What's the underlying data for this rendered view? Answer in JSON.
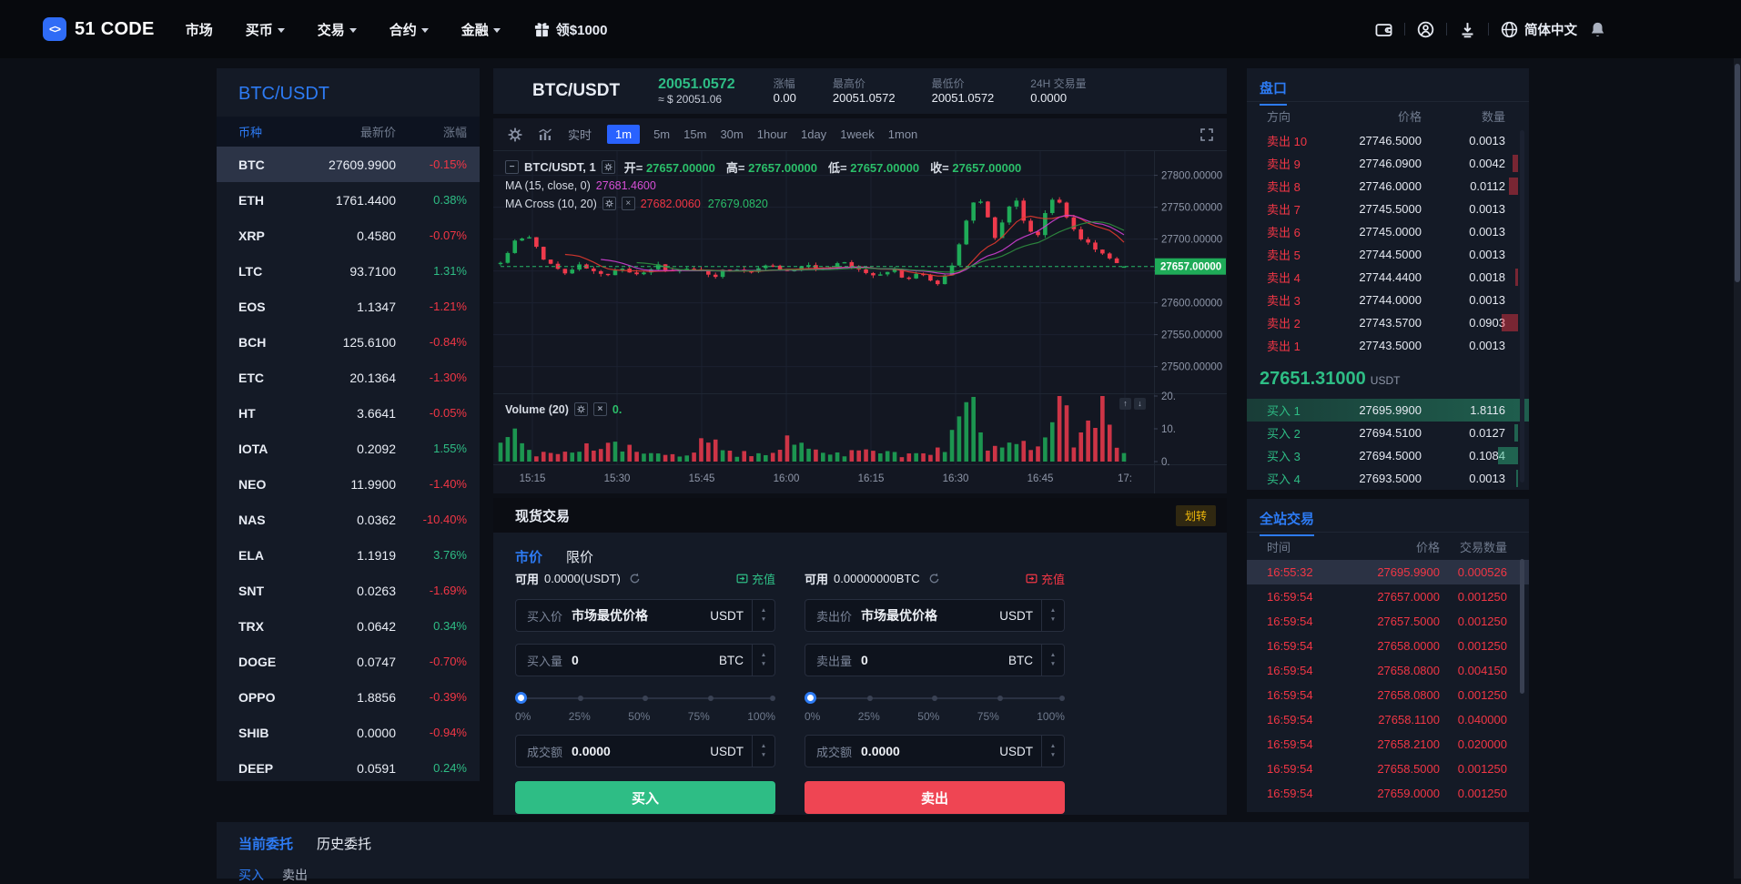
{
  "nav": {
    "logo_text": "51 CODE",
    "items": [
      {
        "label": "市场",
        "caret": false
      },
      {
        "label": "买币",
        "caret": true
      },
      {
        "label": "交易",
        "caret": true
      },
      {
        "label": "合约",
        "caret": true
      },
      {
        "label": "金融",
        "caret": true
      }
    ],
    "promo": "领$1000",
    "language": "简体中文"
  },
  "market": {
    "title": "BTC/USDT",
    "col_coin": "币种",
    "col_price": "最新价",
    "col_change": "涨幅",
    "rows": [
      {
        "coin": "BTC",
        "price": "27609.9900",
        "change": "-0.15%",
        "dir": "down",
        "selected": true
      },
      {
        "coin": "ETH",
        "price": "1761.4400",
        "change": "0.38%",
        "dir": "up"
      },
      {
        "coin": "XRP",
        "price": "0.4580",
        "change": "-0.07%",
        "dir": "down"
      },
      {
        "coin": "LTC",
        "price": "93.7100",
        "change": "1.31%",
        "dir": "up"
      },
      {
        "coin": "EOS",
        "price": "1.1347",
        "change": "-1.21%",
        "dir": "down"
      },
      {
        "coin": "BCH",
        "price": "125.6100",
        "change": "-0.84%",
        "dir": "down"
      },
      {
        "coin": "ETC",
        "price": "20.1364",
        "change": "-1.30%",
        "dir": "down"
      },
      {
        "coin": "HT",
        "price": "3.6641",
        "change": "-0.05%",
        "dir": "down"
      },
      {
        "coin": "IOTA",
        "price": "0.2092",
        "change": "1.55%",
        "dir": "up"
      },
      {
        "coin": "NEO",
        "price": "11.9900",
        "change": "-1.40%",
        "dir": "down"
      },
      {
        "coin": "NAS",
        "price": "0.0362",
        "change": "-10.40%",
        "dir": "down"
      },
      {
        "coin": "ELA",
        "price": "1.1919",
        "change": "3.76%",
        "dir": "up"
      },
      {
        "coin": "SNT",
        "price": "0.0263",
        "change": "-1.69%",
        "dir": "down"
      },
      {
        "coin": "TRX",
        "price": "0.0642",
        "change": "0.34%",
        "dir": "up"
      },
      {
        "coin": "DOGE",
        "price": "0.0747",
        "change": "-0.70%",
        "dir": "down"
      },
      {
        "coin": "OPPO",
        "price": "1.8856",
        "change": "-0.39%",
        "dir": "down"
      },
      {
        "coin": "SHIB",
        "price": "0.0000",
        "change": "-0.94%",
        "dir": "down"
      },
      {
        "coin": "DEEP",
        "price": "0.0591",
        "change": "0.24%",
        "dir": "up"
      }
    ]
  },
  "ticker": {
    "pair": "BTC/USDT",
    "price": "20051.0572",
    "approx": "≈ $ 20051.06",
    "stats": [
      {
        "label": "涨幅",
        "value": "0.00",
        "green": true
      },
      {
        "label": "最高价",
        "value": "20051.0572"
      },
      {
        "label": "最低价",
        "value": "20051.0572"
      },
      {
        "label": "24H 交易量",
        "value": "0.0000"
      }
    ]
  },
  "chart": {
    "realtime": "实时",
    "intervals": [
      "1m",
      "5m",
      "15m",
      "30m",
      "1hour",
      "1day",
      "1week",
      "1mon"
    ],
    "active_interval": "1m",
    "legend_symbol": "BTC/USDT, 1",
    "ohlc": [
      {
        "k": "开=",
        "v": "27657.00000"
      },
      {
        "k": "高=",
        "v": "27657.00000"
      },
      {
        "k": "低=",
        "v": "27657.00000"
      },
      {
        "k": "收=",
        "v": "27657.00000"
      }
    ],
    "ma_label": "MA (15, close, 0)",
    "ma_value": "27681.4600",
    "macross_label": "MA Cross (10, 20)",
    "macross_v1": "27682.0060",
    "macross_v2": "27679.0820",
    "vol_label": "Volume (20)",
    "vol_value": "0."
  },
  "chart_data": {
    "type": "candlestick",
    "symbol": "BTC/USDT",
    "interval": "1m",
    "x_labels": [
      "15:15",
      "15:30",
      "15:45",
      "16:00",
      "16:15",
      "16:30",
      "16:45",
      "17:"
    ],
    "y_ticks": [
      "27800.00000",
      "27750.00000",
      "27700.00000",
      "27650.00000",
      "27600.00000",
      "27550.00000",
      "27500.00000"
    ],
    "y_tick_prices": [
      27800,
      27750,
      27700,
      27650,
      27600,
      27550,
      27500
    ],
    "vol_ticks": [
      "20.",
      "10.",
      "0."
    ],
    "vol_max": 20,
    "price_range": [
      27458,
      27838
    ],
    "last_price": 27657,
    "price_tag": "27657.00000",
    "candle_count": 88,
    "price_anchors": [
      [
        0.0,
        27662
      ],
      [
        0.02,
        27694
      ],
      [
        0.045,
        27703
      ],
      [
        0.07,
        27668
      ],
      [
        0.1,
        27648
      ],
      [
        0.13,
        27660
      ],
      [
        0.16,
        27642
      ],
      [
        0.19,
        27652
      ],
      [
        0.22,
        27644
      ],
      [
        0.25,
        27658
      ],
      [
        0.28,
        27647
      ],
      [
        0.31,
        27655
      ],
      [
        0.34,
        27642
      ],
      [
        0.37,
        27655
      ],
      [
        0.4,
        27650
      ],
      [
        0.43,
        27661
      ],
      [
        0.46,
        27649
      ],
      [
        0.49,
        27659
      ],
      [
        0.52,
        27650
      ],
      [
        0.55,
        27663
      ],
      [
        0.575,
        27650
      ],
      [
        0.6,
        27641
      ],
      [
        0.625,
        27654
      ],
      [
        0.65,
        27638
      ],
      [
        0.675,
        27646
      ],
      [
        0.7,
        27628
      ],
      [
        0.72,
        27650
      ],
      [
        0.735,
        27690
      ],
      [
        0.75,
        27742
      ],
      [
        0.765,
        27768
      ],
      [
        0.78,
        27738
      ],
      [
        0.795,
        27700
      ],
      [
        0.81,
        27740
      ],
      [
        0.825,
        27770
      ],
      [
        0.84,
        27726
      ],
      [
        0.86,
        27698
      ],
      [
        0.875,
        27745
      ],
      [
        0.89,
        27772
      ],
      [
        0.905,
        27740
      ],
      [
        0.925,
        27705
      ],
      [
        0.945,
        27692
      ],
      [
        0.965,
        27678
      ],
      [
        0.985,
        27662
      ],
      [
        1.0,
        27657
      ]
    ],
    "vol_anchors": [
      [
        0,
        5
      ],
      [
        0.02,
        8
      ],
      [
        0.05,
        3
      ],
      [
        0.08,
        2
      ],
      [
        0.11,
        3
      ],
      [
        0.14,
        5
      ],
      [
        0.17,
        6
      ],
      [
        0.2,
        4
      ],
      [
        0.23,
        2
      ],
      [
        0.26,
        2.5
      ],
      [
        0.3,
        2
      ],
      [
        0.33,
        7
      ],
      [
        0.36,
        3
      ],
      [
        0.4,
        2
      ],
      [
        0.44,
        2.5
      ],
      [
        0.47,
        9
      ],
      [
        0.5,
        3
      ],
      [
        0.53,
        2
      ],
      [
        0.57,
        2.5
      ],
      [
        0.6,
        3
      ],
      [
        0.63,
        2.5
      ],
      [
        0.66,
        2
      ],
      [
        0.69,
        3
      ],
      [
        0.72,
        6
      ],
      [
        0.74,
        12
      ],
      [
        0.755,
        19
      ],
      [
        0.77,
        7
      ],
      [
        0.79,
        4
      ],
      [
        0.81,
        5
      ],
      [
        0.83,
        7
      ],
      [
        0.85,
        3.5
      ],
      [
        0.87,
        5
      ],
      [
        0.885,
        9
      ],
      [
        0.9,
        18
      ],
      [
        0.92,
        6
      ],
      [
        0.935,
        13
      ],
      [
        0.95,
        8
      ],
      [
        0.965,
        15
      ],
      [
        0.98,
        9
      ],
      [
        1.0,
        2
      ]
    ]
  },
  "spot": {
    "title": "现货交易",
    "transfer": "划转",
    "tab_market": "市价",
    "tab_limit": "限价",
    "percents": [
      "0%",
      "25%",
      "50%",
      "75%",
      "100%"
    ],
    "buy": {
      "avail_label": "可用",
      "avail": "0.0000(USDT)",
      "recharge": "充值",
      "price_label": "买入价",
      "price_value": "市场最优价格",
      "price_unit": "USDT",
      "qty_label": "买入量",
      "qty_value": "0",
      "qty_unit": "BTC",
      "total_label": "成交额",
      "total_value": "0.0000",
      "total_unit": "USDT",
      "submit": "买入"
    },
    "sell": {
      "avail_label": "可用",
      "avail": "0.00000000BTC",
      "recharge": "充值",
      "price_label": "卖出价",
      "price_value": "市场最优价格",
      "price_unit": "USDT",
      "qty_label": "卖出量",
      "qty_value": "0",
      "qty_unit": "BTC",
      "total_label": "成交额",
      "total_value": "0.0000",
      "total_unit": "USDT",
      "submit": "卖出"
    }
  },
  "orderbook": {
    "title": "盘口",
    "col_side": "方向",
    "col_price": "价格",
    "col_qty": "数量",
    "asks": [
      {
        "side": "卖出 10",
        "price": "27746.5000",
        "qty": "0.0013",
        "bar": 0
      },
      {
        "side": "卖出 9",
        "price": "27746.0900",
        "qty": "0.0042",
        "bar": 6
      },
      {
        "side": "卖出 8",
        "price": "27746.0000",
        "qty": "0.0112",
        "bar": 10
      },
      {
        "side": "卖出 7",
        "price": "27745.5000",
        "qty": "0.0013",
        "bar": 0
      },
      {
        "side": "卖出 6",
        "price": "27745.0000",
        "qty": "0.0013",
        "bar": 0
      },
      {
        "side": "卖出 5",
        "price": "27744.5000",
        "qty": "0.0013",
        "bar": 0
      },
      {
        "side": "卖出 4",
        "price": "27744.4400",
        "qty": "0.0018",
        "bar": 3
      },
      {
        "side": "卖出 3",
        "price": "27744.0000",
        "qty": "0.0013",
        "bar": 0
      },
      {
        "side": "卖出 2",
        "price": "27743.5700",
        "qty": "0.0903",
        "bar": 18
      },
      {
        "side": "卖出 1",
        "price": "27743.5000",
        "qty": "0.0013",
        "bar": 0
      }
    ],
    "last_price": "27651.31000",
    "last_unit": "USDT",
    "bids": [
      {
        "side": "买入 1",
        "price": "27695.9900",
        "qty": "1.8116",
        "bar": 0,
        "highlight": true
      },
      {
        "side": "买入 2",
        "price": "27694.5100",
        "qty": "0.0127",
        "bar": 4
      },
      {
        "side": "买入 3",
        "price": "27694.5000",
        "qty": "0.1084",
        "bar": 22
      },
      {
        "side": "买入 4",
        "price": "27693.5000",
        "qty": "0.0013",
        "bar": 2
      }
    ]
  },
  "trades": {
    "title": "全站交易",
    "col_time": "时间",
    "col_price": "价格",
    "col_qty": "交易数量",
    "rows": [
      {
        "time": "16:55:32",
        "price": "27695.9900",
        "qty": "0.000526",
        "highlight": true
      },
      {
        "time": "16:59:54",
        "price": "27657.0000",
        "qty": "0.001250"
      },
      {
        "time": "16:59:54",
        "price": "27657.5000",
        "qty": "0.001250"
      },
      {
        "time": "16:59:54",
        "price": "27658.0000",
        "qty": "0.001250"
      },
      {
        "time": "16:59:54",
        "price": "27658.0800",
        "qty": "0.004150"
      },
      {
        "time": "16:59:54",
        "price": "27658.0800",
        "qty": "0.001250"
      },
      {
        "time": "16:59:54",
        "price": "27658.1100",
        "qty": "0.040000"
      },
      {
        "time": "16:59:54",
        "price": "27658.2100",
        "qty": "0.020000"
      },
      {
        "time": "16:59:54",
        "price": "27658.5000",
        "qty": "0.001250"
      },
      {
        "time": "16:59:54",
        "price": "27659.0000",
        "qty": "0.001250"
      }
    ]
  },
  "orders": {
    "tab_current": "当前委托",
    "tab_history": "历史委托",
    "sub_buy": "买入",
    "sub_sell": "卖出"
  },
  "colors": {
    "accent_blue": "#2d7bf4",
    "up_green": "#2ebd85",
    "down_red": "#f23645",
    "candle_up": "#1fab58",
    "candle_down": "#ef3a4c",
    "warn_orange": "#f0b90b"
  }
}
